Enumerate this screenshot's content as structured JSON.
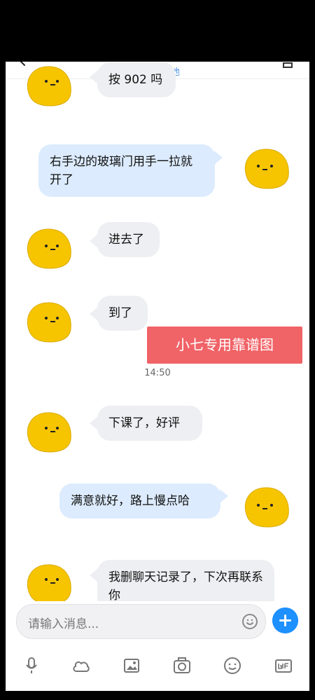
{
  "header": {
    "ip_link": "查看IP属地",
    "back_icon": "back-arrow-icon",
    "profile_icon": "profile-icon"
  },
  "messages": [
    {
      "side": "left",
      "text": "按 902 吗"
    },
    {
      "side": "right",
      "text": "右手边的玻璃门用手一拉就开了"
    },
    {
      "side": "left",
      "text": "进去了"
    },
    {
      "side": "left",
      "text": "到了"
    },
    {
      "side": "left",
      "text": "下课了，好评"
    },
    {
      "side": "right",
      "text": "满意就好，路上慢点哈"
    },
    {
      "side": "left",
      "text": "我删聊天记录了，下次再联系你"
    }
  ],
  "timestamp": "14:50",
  "watermark": "小七专用靠谱图",
  "input": {
    "placeholder": "请输入消息..."
  },
  "toolbar": {
    "icons": [
      "microphone-icon",
      "cloud-icon",
      "image-icon",
      "camera-icon",
      "emoji-icon",
      "gif-icon"
    ]
  },
  "colors": {
    "left_bubble": "#eeeff2",
    "right_bubble": "#dcebfd",
    "accent_blue": "#1e90ff",
    "watermark_red": "#f06367"
  }
}
